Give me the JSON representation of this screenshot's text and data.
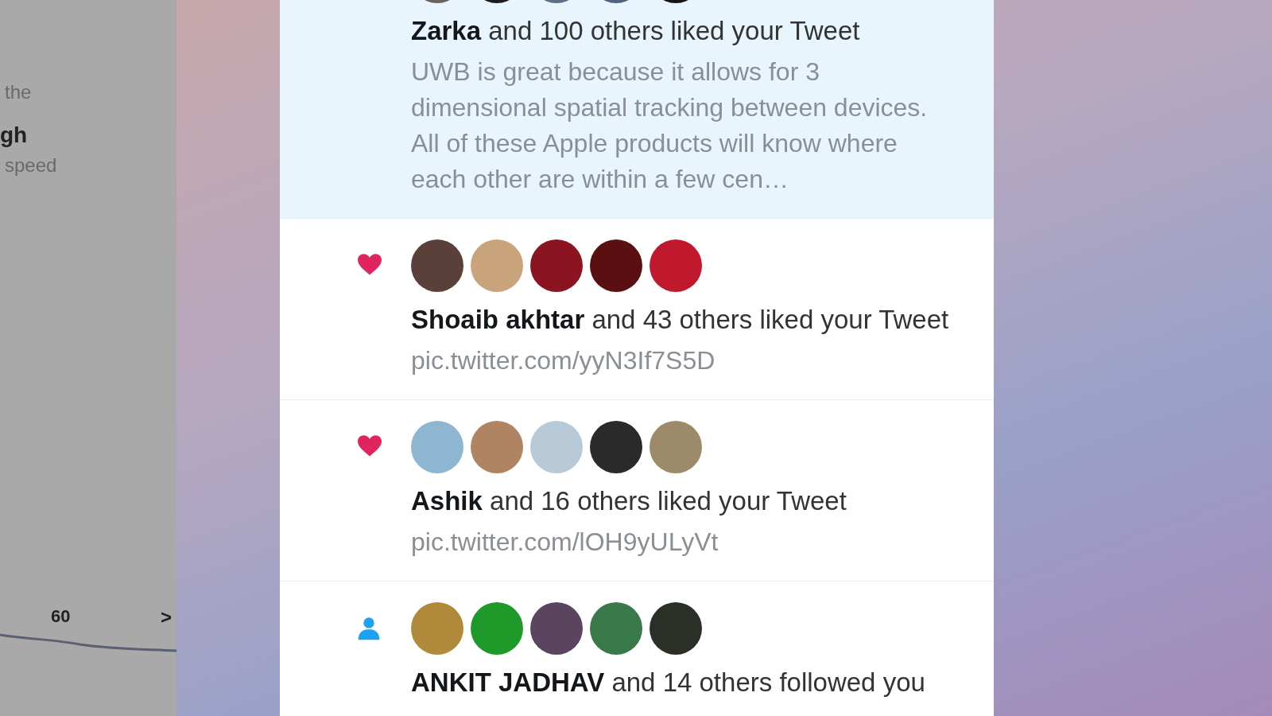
{
  "background_window": {
    "texts": [
      {
        "text": "the",
        "kind": "plain"
      },
      {
        "text": "gh",
        "kind": "bold"
      },
      {
        "text": "speed",
        "kind": "plain"
      }
    ],
    "axis_label": "60",
    "arrow": ">"
  },
  "notifications": [
    {
      "kind": "like",
      "unread": true,
      "avatars": [
        {
          "color": "#6b625c"
        },
        {
          "color": "#1c1c1c"
        },
        {
          "color": "#5c6f86"
        },
        {
          "color": "#4f6380"
        },
        {
          "color": "#151515"
        }
      ],
      "name": "Zarka",
      "action": " and 100 others liked your Tweet",
      "preview": "UWB is great because it allows for 3 dimensional spatial tracking between devices. All of these Apple products will know where each other are within a few cen…"
    },
    {
      "kind": "like",
      "unread": false,
      "avatars": [
        {
          "color": "#5a4038"
        },
        {
          "color": "#c9a37a"
        },
        {
          "color": "#8c1420"
        },
        {
          "color": "#5a1010"
        },
        {
          "color": "#c0182c"
        }
      ],
      "name": "Shoaib akhtar",
      "action": " and 43 others liked your Tweet",
      "preview": "pic.twitter.com/yyN3If7S5D"
    },
    {
      "kind": "like",
      "unread": false,
      "avatars": [
        {
          "color": "#8fb6d0"
        },
        {
          "color": "#b08462"
        },
        {
          "color": "#b8cad8"
        },
        {
          "color": "#2a2a2a"
        },
        {
          "color": "#9c8a6a"
        }
      ],
      "name": "Ashik",
      "action": " and 16 others liked your Tweet",
      "preview": "pic.twitter.com/lOH9yULyVt"
    },
    {
      "kind": "follow",
      "unread": false,
      "avatars": [
        {
          "color": "#b08a3a"
        },
        {
          "color": "#1f9a2a"
        },
        {
          "color": "#5a4460"
        },
        {
          "color": "#3a7a4a"
        },
        {
          "color": "#2a3028"
        }
      ],
      "name": "ANKIT JADHAV",
      "action": " and 14 others followed you"
    }
  ]
}
